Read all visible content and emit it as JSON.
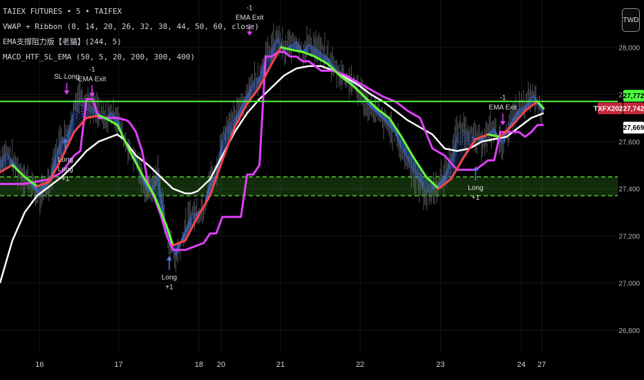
{
  "legend": {
    "line1": "TAIEX FUTURES • 5 • TAIFEX",
    "line2": "VWAP + Ribbon (8, 14, 20, 26, 32, 38, 44, 50, 60, close)",
    "line3": "EMA支撐阻力版【老貓】(244, 5)",
    "line4": "MACD_HTF_SL_EMA (50, 5, 20, 200, 300, 400)"
  },
  "currency": "TWD",
  "colors": {
    "background": "#000000",
    "resistance_line": "#4cff3c",
    "support_zone": "#3fa329",
    "vwap": "#ffffff",
    "ema_up": "#ff4444",
    "ema_down": "#66ff33",
    "step_line": "#e040fb",
    "ribbon": "#3f6fd6",
    "candles": "#6b7079",
    "signal_long": "#4f7df0",
    "signal_exit": "#e040fb",
    "badge_green": "#4cff3c",
    "badge_red": "#c2293a",
    "badge_white": "#ffffff"
  },
  "chart_data": {
    "type": "line",
    "x_labels": [
      "16",
      "17",
      "18",
      "20",
      "21",
      "22",
      "23",
      "24",
      "27"
    ],
    "ylim": [
      26700,
      28200
    ],
    "y_ticks": [
      "28,000",
      "27,800",
      "27,600",
      "27,400",
      "27,200",
      "27,000",
      "26,800"
    ],
    "y_tick_values": [
      28000,
      27800,
      27600,
      27400,
      27200,
      27000,
      26800
    ],
    "x_range": [
      0,
      100
    ],
    "x_positions": [
      6.4,
      19.2,
      32.2,
      35.8,
      45.4,
      58.3,
      71.3,
      84.4,
      87.7
    ],
    "series": [
      {
        "key": "price",
        "x": [
          0,
          1,
          3,
          5,
          6.5,
          7.2,
          8,
          9,
          10,
          11,
          11.6,
          12,
          13,
          14,
          15,
          16,
          17,
          18,
          19,
          20,
          21,
          22,
          23,
          24,
          25,
          25.5,
          26,
          27,
          28,
          28.3,
          29,
          30,
          31,
          32,
          33,
          34,
          35,
          36,
          37,
          38,
          39,
          40,
          41,
          42,
          43,
          44,
          45,
          46,
          47,
          48,
          49,
          50,
          51,
          52,
          53,
          54,
          55,
          56,
          57,
          58,
          59,
          60,
          61,
          62,
          63,
          64,
          65,
          66,
          67,
          68,
          69,
          70,
          71,
          72,
          72.8,
          73.5,
          74,
          75,
          76,
          77,
          78,
          79,
          80,
          80.8,
          81.5,
          82,
          83,
          84,
          85,
          85.8,
          86.5,
          87,
          88
        ],
        "y": [
          27520,
          27560,
          27480,
          27420,
          27360,
          27400,
          27430,
          27550,
          27620,
          27640,
          27700,
          27760,
          27800,
          27770,
          27750,
          27720,
          27690,
          27730,
          27700,
          27620,
          27560,
          27530,
          27440,
          27380,
          27430,
          27480,
          27400,
          27200,
          27140,
          27090,
          27150,
          27230,
          27300,
          27300,
          27320,
          27440,
          27460,
          27620,
          27680,
          27700,
          27750,
          27800,
          27860,
          27880,
          27960,
          28000,
          28050,
          27980,
          28010,
          28030,
          27980,
          28020,
          28000,
          27980,
          27960,
          27920,
          27890,
          27870,
          27850,
          27820,
          27780,
          27740,
          27720,
          27690,
          27660,
          27630,
          27560,
          27520,
          27460,
          27420,
          27370,
          27390,
          27420,
          27460,
          27520,
          27580,
          27640,
          27660,
          27640,
          27610,
          27600,
          27630,
          27660,
          27600,
          27580,
          27640,
          27700,
          27740,
          27750,
          27790,
          27800,
          27760,
          27720
        ]
      },
      {
        "key": "ema_fast",
        "x": [
          0,
          2,
          4,
          6,
          8,
          10,
          12,
          14,
          16,
          17,
          19,
          21,
          23,
          25,
          27,
          28,
          30,
          32,
          34,
          36,
          38,
          40,
          42,
          44,
          45.5,
          47,
          49,
          51,
          53,
          55,
          57,
          59,
          61,
          63,
          65,
          67,
          69,
          71,
          73,
          75,
          77,
          79,
          81,
          83,
          85,
          87,
          88
        ],
        "y": [
          27470,
          27500,
          27450,
          27410,
          27430,
          27530,
          27640,
          27700,
          27710,
          27700,
          27670,
          27560,
          27460,
          27370,
          27240,
          27160,
          27180,
          27280,
          27370,
          27520,
          27660,
          27760,
          27830,
          27930,
          28000,
          27990,
          27980,
          27960,
          27930,
          27880,
          27840,
          27790,
          27740,
          27700,
          27620,
          27530,
          27450,
          27400,
          27440,
          27530,
          27610,
          27630,
          27620,
          27670,
          27730,
          27770,
          27740
        ]
      },
      {
        "key": "step_line",
        "x": [
          0,
          2,
          4,
          6,
          8,
          10,
          12,
          13,
          14,
          15,
          16,
          17,
          18,
          19,
          20.5,
          21,
          22,
          23,
          24,
          25,
          26,
          27,
          28,
          30,
          32,
          33,
          34,
          35,
          36,
          37,
          38,
          39,
          40,
          41,
          42,
          43,
          44,
          45,
          46,
          47,
          48,
          49,
          50,
          52,
          54,
          56,
          58,
          60,
          62,
          64,
          66,
          68,
          70,
          72,
          74,
          75,
          76,
          77,
          78,
          79,
          80,
          81,
          82,
          83,
          84,
          85,
          86,
          87,
          88
        ],
        "y": [
          27420,
          27420,
          27420,
          27430,
          27440,
          27470,
          27540,
          27560,
          27780,
          27780,
          27700,
          27700,
          27700,
          27700,
          27690,
          27680,
          27640,
          27560,
          27420,
          27360,
          27290,
          27200,
          27140,
          27140,
          27160,
          27170,
          27210,
          27210,
          27280,
          27280,
          27280,
          27280,
          27460,
          27460,
          27500,
          27960,
          27960,
          27980,
          27980,
          27960,
          27960,
          27940,
          27940,
          27900,
          27900,
          27880,
          27850,
          27820,
          27790,
          27770,
          27730,
          27700,
          27570,
          27540,
          27480,
          27480,
          27480,
          27480,
          27500,
          27520,
          27520,
          27640,
          27640,
          27640,
          27640,
          27620,
          27640,
          27670,
          27670
        ]
      },
      {
        "key": "vwap",
        "x": [
          0,
          2,
          4,
          6,
          8,
          10,
          12,
          14,
          16,
          18,
          19,
          20,
          22,
          24,
          26,
          28,
          30,
          31,
          32,
          34,
          36,
          38,
          40,
          42,
          44,
          46,
          48,
          50,
          52,
          54,
          56,
          58,
          60,
          62,
          64,
          66,
          68,
          70,
          72,
          74,
          76,
          78,
          80,
          82,
          84,
          86,
          88
        ],
        "y": [
          27000,
          27180,
          27300,
          27370,
          27410,
          27450,
          27500,
          27560,
          27600,
          27620,
          27630,
          27610,
          27540,
          27500,
          27450,
          27400,
          27380,
          27380,
          27390,
          27440,
          27540,
          27640,
          27720,
          27780,
          27830,
          27880,
          27910,
          27920,
          27920,
          27900,
          27870,
          27840,
          27800,
          27770,
          27730,
          27690,
          27660,
          27630,
          27570,
          27560,
          27570,
          27600,
          27610,
          27620,
          27660,
          27700,
          27720
        ]
      }
    ],
    "horizontal_lines": [
      {
        "name": "resistance",
        "y": 27770
      },
      {
        "name": "zone_top",
        "y": 27450
      },
      {
        "name": "zone_bottom",
        "y": 27370
      }
    ],
    "price_badges": [
      {
        "label": "27,772",
        "y": 27772,
        "color": "green"
      },
      {
        "label": "TXFX2025",
        "y": 27742,
        "color": "red"
      },
      {
        "label": "27,742",
        "y": 27742,
        "color": "red"
      },
      {
        "label": "27,669",
        "y": 27669,
        "color": "white"
      }
    ],
    "annotations": [
      {
        "kind": "long",
        "lines": [
          "Long",
          "Long",
          "+1"
        ],
        "x": 10.6,
        "y": 27620
      },
      {
        "kind": "long",
        "lines": [
          "Long",
          "+1"
        ],
        "x": 27.4,
        "y": 27120
      },
      {
        "kind": "long",
        "lines": [
          "Long",
          "+1"
        ],
        "x": 77,
        "y": 27500
      },
      {
        "kind": "exit",
        "lines": [
          "SL Long"
        ],
        "x": 10.8,
        "y": 27790
      },
      {
        "kind": "exit",
        "lines": [
          "-1",
          "EMA Exit"
        ],
        "x": 14.9,
        "y": 27780
      },
      {
        "kind": "exit",
        "lines": [
          "-1",
          "EMA Exit"
        ],
        "x": 40.4,
        "y": 28040
      },
      {
        "kind": "exit",
        "lines": [
          "-1",
          "EMA Exit"
        ],
        "x": 81.4,
        "y": 27660
      }
    ]
  }
}
